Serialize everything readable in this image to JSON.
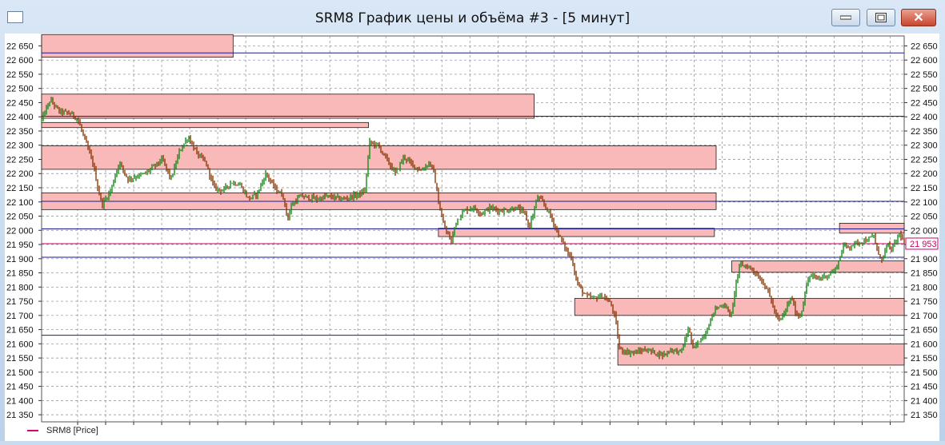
{
  "window": {
    "title": "SRM8 График цены и объёма #3 - [5 минут]",
    "controls": {
      "minimize": "▭",
      "maximize": "❐",
      "close": "✕"
    }
  },
  "legend": {
    "label": "SRM8 [Price]",
    "color": "#e00070"
  },
  "chart_data": {
    "type": "candlestick",
    "title": "",
    "ylim": [
      21325,
      22685
    ],
    "y_ticks": [
      "22 650",
      "22 600",
      "22 550",
      "22 500",
      "22 450",
      "22 400",
      "22 350",
      "22 300",
      "22 250",
      "22 200",
      "22 150",
      "22 100",
      "22 050",
      "22 000",
      "21 950",
      "21 900",
      "21 850",
      "21 800",
      "21 750",
      "21 700",
      "21 650",
      "21 600",
      "21 550",
      "21 500",
      "21 450",
      "21 400",
      "21 350"
    ],
    "current_price": 21953,
    "current_price_label": "21 953",
    "grid": true,
    "colors": {
      "up": "#1a8a1a",
      "down": "#8b3a0a",
      "zone_fill": "#f9b9b9",
      "zone_border": "#1a1a1a",
      "level_line": "#1a1a8c",
      "price_line": "#cc0066"
    },
    "horizontal_levels": [
      22625,
      22402,
      22102,
      22005,
      21905,
      21630
    ],
    "zones": [
      {
        "x_start": 0,
        "x_end": 0.222,
        "y_low": 22610,
        "y_high": 22690
      },
      {
        "x_start": 0,
        "x_end": 0.571,
        "y_low": 22395,
        "y_high": 22480
      },
      {
        "x_start": 0,
        "x_end": 0.379,
        "y_low": 22362,
        "y_high": 22380
      },
      {
        "x_start": 0,
        "x_end": 0.782,
        "y_low": 22215,
        "y_high": 22298
      },
      {
        "x_start": 0,
        "x_end": 0.782,
        "y_low": 22073,
        "y_high": 22132
      },
      {
        "x_start": 0.46,
        "x_end": 0.78,
        "y_low": 21978,
        "y_high": 22007
      },
      {
        "x_start": 0.925,
        "x_end": 1.0,
        "y_low": 21990,
        "y_high": 22025
      },
      {
        "x_start": 0.8,
        "x_end": 1.0,
        "y_low": 21852,
        "y_high": 21892
      },
      {
        "x_start": 0.618,
        "x_end": 1.0,
        "y_low": 21700,
        "y_high": 21760
      },
      {
        "x_start": 0.668,
        "x_end": 1.0,
        "y_low": 21525,
        "y_high": 21600
      }
    ],
    "path_anchors": [
      [
        0.0,
        22390
      ],
      [
        0.01,
        22460
      ],
      [
        0.02,
        22420
      ],
      [
        0.035,
        22410
      ],
      [
        0.042,
        22390
      ],
      [
        0.05,
        22320
      ],
      [
        0.06,
        22230
      ],
      [
        0.065,
        22150
      ],
      [
        0.07,
        22090
      ],
      [
        0.08,
        22140
      ],
      [
        0.09,
        22240
      ],
      [
        0.1,
        22180
      ],
      [
        0.12,
        22200
      ],
      [
        0.14,
        22250
      ],
      [
        0.15,
        22180
      ],
      [
        0.16,
        22280
      ],
      [
        0.17,
        22330
      ],
      [
        0.18,
        22270
      ],
      [
        0.19,
        22240
      ],
      [
        0.2,
        22150
      ],
      [
        0.21,
        22140
      ],
      [
        0.22,
        22170
      ],
      [
        0.23,
        22160
      ],
      [
        0.24,
        22110
      ],
      [
        0.25,
        22130
      ],
      [
        0.26,
        22200
      ],
      [
        0.27,
        22150
      ],
      [
        0.28,
        22120
      ],
      [
        0.285,
        22040
      ],
      [
        0.29,
        22090
      ],
      [
        0.3,
        22120
      ],
      [
        0.32,
        22110
      ],
      [
        0.33,
        22120
      ],
      [
        0.35,
        22110
      ],
      [
        0.36,
        22120
      ],
      [
        0.37,
        22130
      ],
      [
        0.375,
        22140
      ],
      [
        0.38,
        22310
      ],
      [
        0.39,
        22300
      ],
      [
        0.4,
        22250
      ],
      [
        0.41,
        22200
      ],
      [
        0.42,
        22260
      ],
      [
        0.43,
        22230
      ],
      [
        0.44,
        22210
      ],
      [
        0.45,
        22240
      ],
      [
        0.455,
        22200
      ],
      [
        0.46,
        22100
      ],
      [
        0.465,
        22030
      ],
      [
        0.47,
        21990
      ],
      [
        0.475,
        21960
      ],
      [
        0.48,
        22030
      ],
      [
        0.49,
        22070
      ],
      [
        0.5,
        22080
      ],
      [
        0.51,
        22060
      ],
      [
        0.52,
        22080
      ],
      [
        0.53,
        22070
      ],
      [
        0.54,
        22070
      ],
      [
        0.55,
        22080
      ],
      [
        0.56,
        22060
      ],
      [
        0.565,
        22010
      ],
      [
        0.57,
        22060
      ],
      [
        0.575,
        22120
      ],
      [
        0.58,
        22100
      ],
      [
        0.585,
        22080
      ],
      [
        0.59,
        22050
      ],
      [
        0.6,
        21980
      ],
      [
        0.61,
        21920
      ],
      [
        0.615,
        21900
      ],
      [
        0.62,
        21820
      ],
      [
        0.63,
        21770
      ],
      [
        0.64,
        21760
      ],
      [
        0.65,
        21770
      ],
      [
        0.66,
        21740
      ],
      [
        0.665,
        21690
      ],
      [
        0.67,
        21580
      ],
      [
        0.68,
        21570
      ],
      [
        0.69,
        21570
      ],
      [
        0.7,
        21580
      ],
      [
        0.71,
        21570
      ],
      [
        0.72,
        21560
      ],
      [
        0.73,
        21580
      ],
      [
        0.74,
        21570
      ],
      [
        0.745,
        21600
      ],
      [
        0.75,
        21660
      ],
      [
        0.755,
        21580
      ],
      [
        0.76,
        21600
      ],
      [
        0.77,
        21640
      ],
      [
        0.78,
        21720
      ],
      [
        0.79,
        21740
      ],
      [
        0.8,
        21700
      ],
      [
        0.805,
        21820
      ],
      [
        0.81,
        21880
      ],
      [
        0.82,
        21870
      ],
      [
        0.825,
        21860
      ],
      [
        0.83,
        21840
      ],
      [
        0.84,
        21800
      ],
      [
        0.845,
        21760
      ],
      [
        0.85,
        21710
      ],
      [
        0.855,
        21680
      ],
      [
        0.86,
        21700
      ],
      [
        0.865,
        21740
      ],
      [
        0.87,
        21760
      ],
      [
        0.875,
        21700
      ],
      [
        0.88,
        21700
      ],
      [
        0.885,
        21780
      ],
      [
        0.89,
        21840
      ],
      [
        0.9,
        21830
      ],
      [
        0.91,
        21840
      ],
      [
        0.92,
        21860
      ],
      [
        0.925,
        21900
      ],
      [
        0.93,
        21950
      ],
      [
        0.935,
        21940
      ],
      [
        0.94,
        21950
      ],
      [
        0.95,
        21960
      ],
      [
        0.96,
        21970
      ],
      [
        0.965,
        21980
      ],
      [
        0.97,
        21910
      ],
      [
        0.975,
        21900
      ],
      [
        0.98,
        21950
      ],
      [
        0.985,
        21930
      ],
      [
        0.99,
        21960
      ],
      [
        0.995,
        21990
      ],
      [
        1.0,
        21953
      ]
    ]
  }
}
